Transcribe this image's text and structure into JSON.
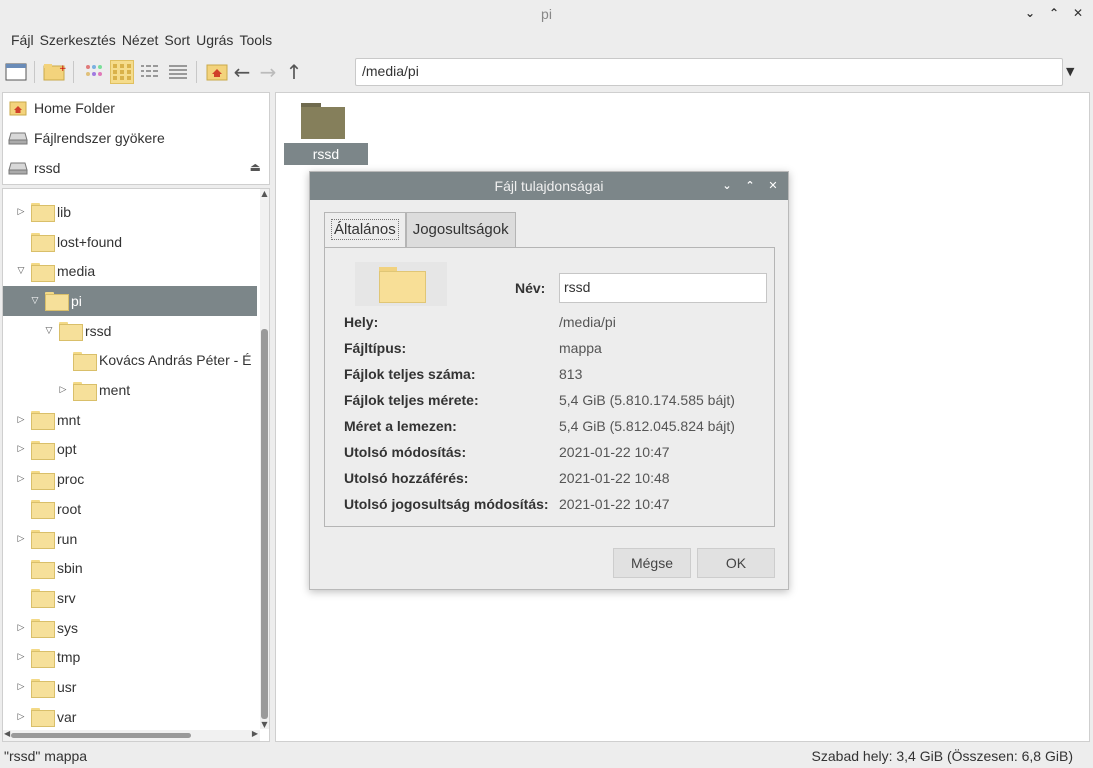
{
  "window": {
    "title": "pi"
  },
  "menu": [
    "Fájl",
    "Szerkesztés",
    "Nézet",
    "Sort",
    "Ugrás",
    "Tools"
  ],
  "address": {
    "path": "/media/pi"
  },
  "places": [
    {
      "label": "Home Folder",
      "icon": "home-icon"
    },
    {
      "label": "Fájlrendszer gyökere",
      "icon": "drive-icon"
    },
    {
      "label": "rssd",
      "icon": "drive-icon",
      "eject": true
    }
  ],
  "tree": [
    {
      "label": "lib",
      "level": 0,
      "expander": "collapsed"
    },
    {
      "label": "lost+found",
      "level": 0,
      "expander": "none"
    },
    {
      "label": "media",
      "level": 0,
      "expander": "expanded"
    },
    {
      "label": "pi",
      "level": 1,
      "expander": "expanded",
      "selected": true
    },
    {
      "label": "rssd",
      "level": 2,
      "expander": "expanded"
    },
    {
      "label": "Kovács András Péter - É",
      "level": 3,
      "expander": "none"
    },
    {
      "label": "ment",
      "level": 3,
      "expander": "collapsed"
    },
    {
      "label": "mnt",
      "level": 0,
      "expander": "collapsed"
    },
    {
      "label": "opt",
      "level": 0,
      "expander": "collapsed"
    },
    {
      "label": "proc",
      "level": 0,
      "expander": "collapsed"
    },
    {
      "label": "root",
      "level": 0,
      "expander": "none"
    },
    {
      "label": "run",
      "level": 0,
      "expander": "collapsed"
    },
    {
      "label": "sbin",
      "level": 0,
      "expander": "none"
    },
    {
      "label": "srv",
      "level": 0,
      "expander": "none"
    },
    {
      "label": "sys",
      "level": 0,
      "expander": "collapsed"
    },
    {
      "label": "tmp",
      "level": 0,
      "expander": "collapsed"
    },
    {
      "label": "usr",
      "level": 0,
      "expander": "collapsed"
    },
    {
      "label": "var",
      "level": 0,
      "expander": "collapsed"
    }
  ],
  "files": [
    {
      "label": "rssd"
    }
  ],
  "status": {
    "left": "\"rssd\" mappa",
    "right": "Szabad hely: 3,4 GiB (Összesen: 6,8 GiB)"
  },
  "dialog": {
    "title": "Fájl tulajdonságai",
    "tabs": [
      "Általános",
      "Jogosultságok"
    ],
    "name_label": "Név:",
    "name_value": "rssd",
    "props": [
      {
        "key": "Hely:",
        "value": "/media/pi"
      },
      {
        "key": "Fájltípus:",
        "value": "mappa"
      },
      {
        "key": "Fájlok teljes száma:",
        "value": "813"
      },
      {
        "key": "Fájlok teljes mérete:",
        "value": "5,4 GiB (5.810.174.585 bájt)"
      },
      {
        "key": "Méret a lemezen:",
        "value": "5,4 GiB (5.812.045.824 bájt)"
      },
      {
        "key": "Utolsó módosítás:",
        "value": "2021-01-22 10:47"
      },
      {
        "key": "Utolsó hozzáférés:",
        "value": "2021-01-22 10:48"
      },
      {
        "key": "Utolsó jogosultság módosítás:",
        "value": "2021-01-22 10:47"
      }
    ],
    "cancel_label": "Mégse",
    "ok_label": "OK"
  }
}
